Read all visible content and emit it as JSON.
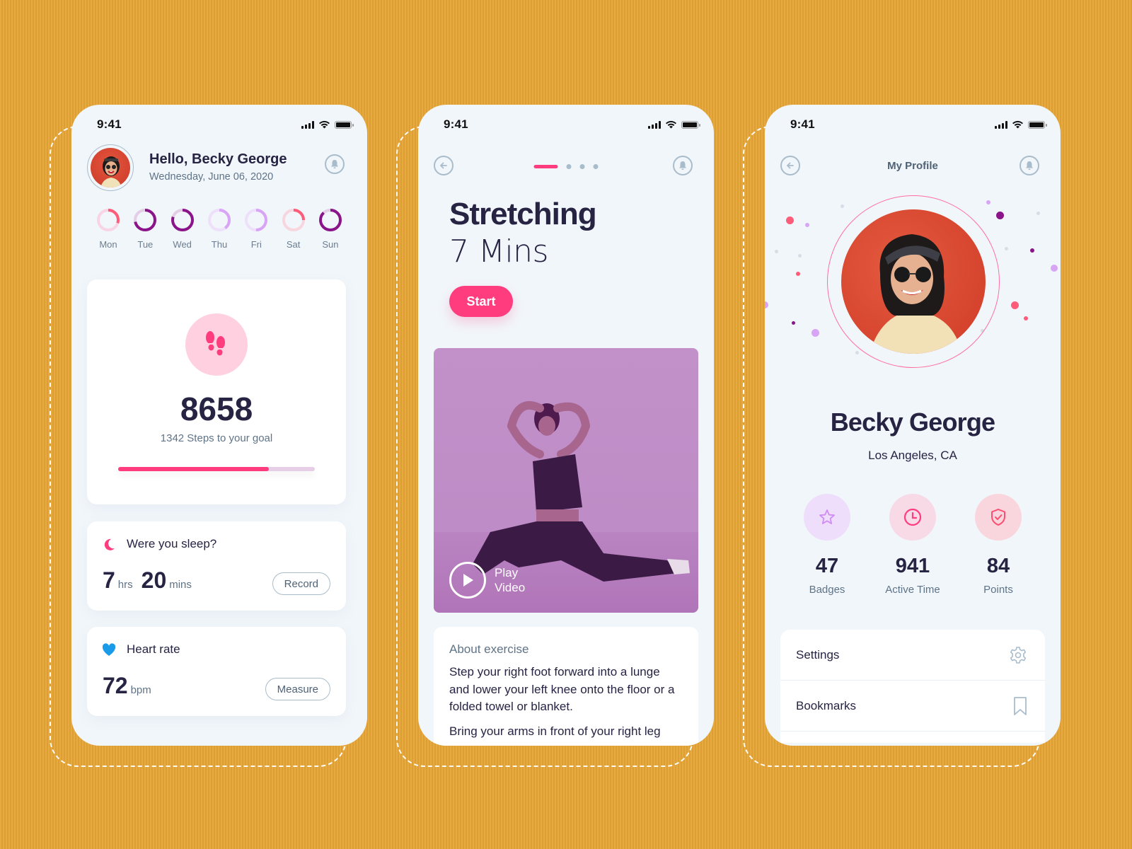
{
  "colors": {
    "background": "#E6A536",
    "accent_pink": "#FF3C7E",
    "purple": "#8A1489",
    "lilac": "#D8A4F6",
    "text_dark": "#262343",
    "text_muted": "#5F7387",
    "icon_gray": "#A9BCCB",
    "heart_blue": "#1A9BEA"
  },
  "status_bar": {
    "time": "9:41"
  },
  "dashboard": {
    "greeting": "Hello, Becky George",
    "date": "Wednesday, June 06, 2020",
    "icons": {
      "notification": "bell-icon",
      "avatar": "user-avatar"
    },
    "days": [
      {
        "label": "Mon",
        "progress": 0.3,
        "color": "#FF5C7A",
        "track": "#F8D4E4"
      },
      {
        "label": "Tue",
        "progress": 0.72,
        "color": "#8A1489",
        "track": "#E4CDE6"
      },
      {
        "label": "Wed",
        "progress": 0.8,
        "color": "#8A1489",
        "track": "#E4CDE6"
      },
      {
        "label": "Thu",
        "progress": 0.4,
        "color": "#D8A4F6",
        "track": "#EEDFFB"
      },
      {
        "label": "Fri",
        "progress": 0.5,
        "color": "#D8A4F6",
        "track": "#EEDFFB"
      },
      {
        "label": "Sat",
        "progress": 0.25,
        "color": "#FF5C7A",
        "track": "#F8D6DF"
      },
      {
        "label": "Sun",
        "progress": 0.88,
        "color": "#8A1489",
        "track": "#E4CDE6"
      }
    ],
    "steps": {
      "icon": "footsteps-icon",
      "value": "8658",
      "subtitle": "1342 Steps to your goal",
      "progress_percent": 76.5
    },
    "sleep": {
      "icon": "moon-icon",
      "title": "Were you sleep?",
      "hours": "7",
      "hours_unit": "hrs",
      "minutes": "20",
      "minutes_unit": "mins",
      "button": "Record"
    },
    "heart": {
      "icon": "heart-icon",
      "title": "Heart rate",
      "value": "72",
      "unit": "bpm",
      "button": "Measure"
    }
  },
  "exercise": {
    "icons": {
      "back": "back-arrow-icon",
      "notification": "bell-icon"
    },
    "pager": {
      "total": 4,
      "active": 0
    },
    "title": "Stretching",
    "duration": "7 Mins",
    "start_button": "Start",
    "video": {
      "play_label_line1": "Play",
      "play_label_line2": "Video",
      "icon": "play-icon"
    },
    "about": {
      "title": "About exercise",
      "paragraphs": [
        "Step your right foot forward into a lunge and lower your left knee onto the floor or a folded towel or blanket.",
        "Bring your arms in front of your right leg"
      ]
    }
  },
  "profile": {
    "header_title": "My Profile",
    "icons": {
      "back": "back-arrow-icon",
      "notification": "bell-icon"
    },
    "name": "Becky George",
    "location": "Los Angeles, CA",
    "stats": [
      {
        "value": "47",
        "label": "Badges",
        "icon": "star-icon",
        "bg": "#EEDDFB",
        "color": "#D08CF5"
      },
      {
        "value": "941",
        "label": "Active Time",
        "icon": "clock-icon",
        "bg": "#F8D9E6",
        "color": "#FF3C7E"
      },
      {
        "value": "84",
        "label": "Points",
        "icon": "shield-check-icon",
        "bg": "#F9D6DD",
        "color": "#FF4D6D"
      }
    ],
    "menu": [
      {
        "label": "Settings",
        "icon": "gear-icon"
      },
      {
        "label": "Bookmarks",
        "icon": "bookmark-icon"
      }
    ]
  }
}
